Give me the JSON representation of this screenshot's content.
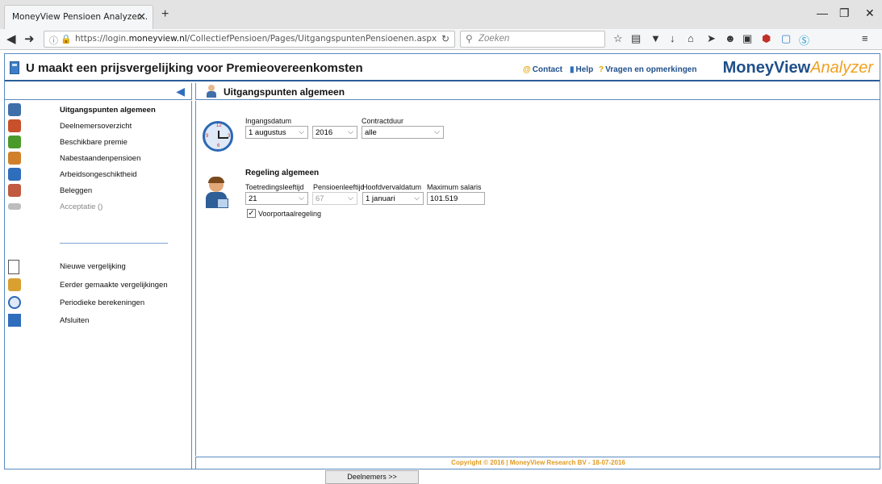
{
  "browser": {
    "tab_title": "MoneyView Pensioen Analyzer...",
    "url_prefix": "https://login.",
    "url_domain": "moneyview.nl",
    "url_path": "/CollectiefPensioen/Pages/UitgangspuntenPensioenen.aspx",
    "search_placeholder": "Zoeken"
  },
  "app": {
    "title": "U maakt een prijsvergelijking voor Premieovereenkomsten",
    "links": {
      "contact": "Contact",
      "help": "Help",
      "questions": "Vragen en opmerkingen"
    },
    "brand_main": "MoneyView",
    "brand_accent": "Analyzer"
  },
  "panel_title": "Uitgangspunten algemeen",
  "sidebar": {
    "items": [
      {
        "label": "Uitgangspunten algemeen",
        "icon": "person-icon",
        "color": "#3f6fa8"
      },
      {
        "label": "Deelnemersoverzicht",
        "icon": "group-icon",
        "color": "#c8502a"
      },
      {
        "label": "Beschikbare premie",
        "icon": "money-person-icon",
        "color": "#4a9a2a"
      },
      {
        "label": "Nabestaandenpensioen",
        "icon": "family-icon",
        "color": "#d0802a"
      },
      {
        "label": "Arbeidsongeschiktheid",
        "icon": "wheelchair-icon",
        "color": "#2f6dbd"
      },
      {
        "label": "Beleggen",
        "icon": "invest-icon",
        "color": "#c05a40"
      },
      {
        "label": "Acceptatie ()",
        "icon": "handshake-icon",
        "color": "#9a9a9a"
      }
    ],
    "actions": [
      {
        "label": "Nieuwe vergelijking",
        "icon": "new-document-icon",
        "color": "#ffffff"
      },
      {
        "label": "Eerder gemaakte vergelijkingen",
        "icon": "archive-icon",
        "color": "#d9a030"
      },
      {
        "label": "Periodieke berekeningen",
        "icon": "clock-icon",
        "color": "#2c68b5"
      },
      {
        "label": "Afsluiten",
        "icon": "exit-door-icon",
        "color": "#2f6dbd"
      }
    ]
  },
  "form": {
    "ingangsdatum_label": "Ingangsdatum",
    "ingangsdatum_day": "1 augustus",
    "ingangsdatum_year": "2016",
    "contractduur_label": "Contractduur",
    "contractduur_value": "alle",
    "regeling_title": "Regeling algemeen",
    "toetredingsleeftijd_label": "Toetredingsleeftijd",
    "toetredingsleeftijd_value": "21",
    "pensioenleeftijd_label": "Pensioenleeftijd",
    "pensioenleeftijd_value": "67",
    "hoofdvervaldatum_label": "Hoofdvervaldatum",
    "hoofdvervaldatum_value": "1 januari",
    "maximum_salaris_label": "Maximum salaris",
    "maximum_salaris_value": "101.519",
    "voorportaal_label": "Voorportaalregeling",
    "voorportaal_checked": true
  },
  "next_button": "Deelnemers >>",
  "footer": "Copyright © 2016 | MoneyView Research BV - 18-07-2016",
  "clock_numbers": {
    "n12": "12",
    "n3": "3",
    "n6": "6",
    "n9": "9"
  }
}
